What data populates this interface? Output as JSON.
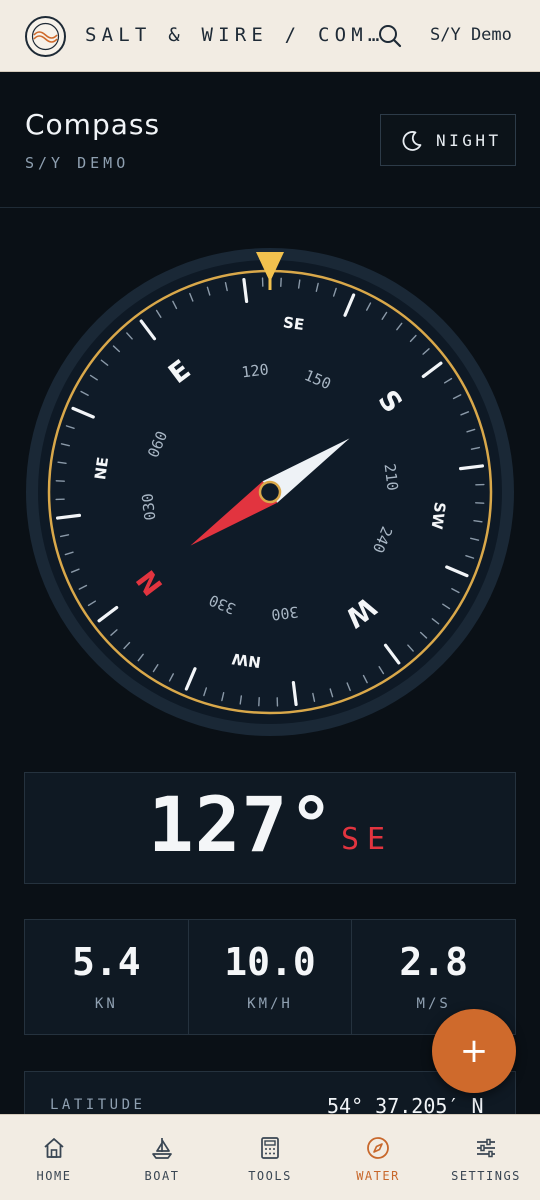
{
  "app": {
    "brand": "SALT & WIRE / COM…",
    "vessel": "S/Y Demo"
  },
  "page": {
    "title": "Compass",
    "subtitle": "S/Y DEMO",
    "mode_button": "NIGHT"
  },
  "compass": {
    "rotation_deg": 127,
    "needle_deg": 56,
    "cardinals": [
      "N",
      "E",
      "S",
      "W"
    ],
    "intercardinals": [
      "NE",
      "SE",
      "SW",
      "NW"
    ],
    "degree_labels": [
      "030",
      "060",
      "120",
      "150",
      "210",
      "240",
      "300",
      "330"
    ],
    "colors": {
      "ring": "#d9a84a",
      "north": "#e2343f",
      "needle_white": "#eef2f6",
      "face": "#0f1b28",
      "bezel": "#1a2836"
    }
  },
  "heading": {
    "degrees": "127°",
    "direction": "SE"
  },
  "speeds": [
    {
      "value": "5.4",
      "unit": "KN"
    },
    {
      "value": "10.0",
      "unit": "KM/H"
    },
    {
      "value": "2.8",
      "unit": "M/S"
    }
  ],
  "position": {
    "latitude_label": "LATITUDE",
    "latitude_value": "54° 37.205′ N"
  },
  "fab": {
    "label": "+"
  },
  "nav": [
    {
      "label": "HOME",
      "icon": "home-icon"
    },
    {
      "label": "BOAT",
      "icon": "sailboat-icon"
    },
    {
      "label": "TOOLS",
      "icon": "calculator-icon"
    },
    {
      "label": "WATER",
      "icon": "compass-icon",
      "active": true
    },
    {
      "label": "SETTINGS",
      "icon": "sliders-icon"
    }
  ]
}
